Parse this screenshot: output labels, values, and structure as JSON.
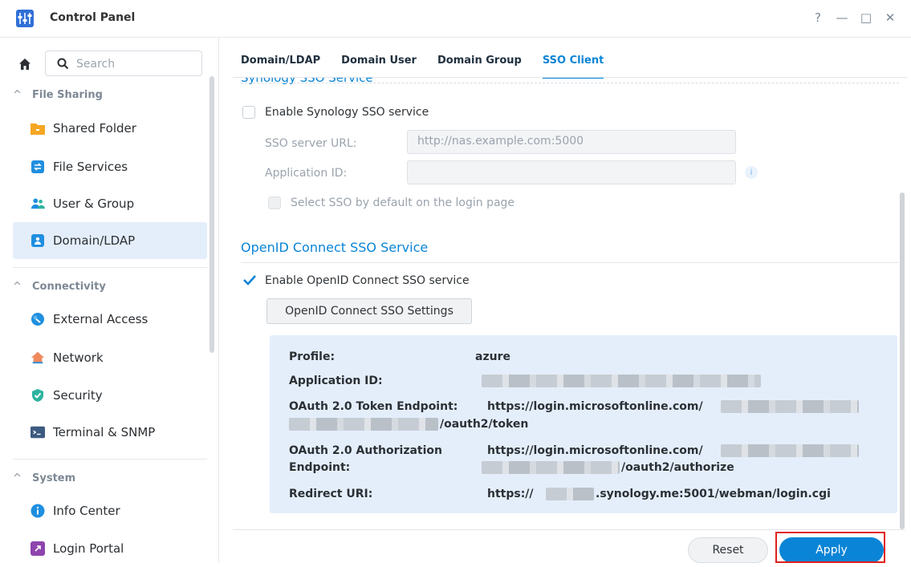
{
  "window": {
    "title": "Control Panel",
    "controls": {
      "help": "?",
      "minimize": "—",
      "maximize": "□",
      "close": "✕"
    }
  },
  "sidebar": {
    "search_placeholder": "Search",
    "sections": {
      "file_sharing": "File Sharing",
      "connectivity": "Connectivity",
      "system": "System"
    },
    "items": {
      "shared_folder": "Shared Folder",
      "file_services": "File Services",
      "user_group": "User & Group",
      "domain_ldap": "Domain/LDAP",
      "external_access": "External Access",
      "network": "Network",
      "security": "Security",
      "terminal_snmp": "Terminal & SNMP",
      "info_center": "Info Center",
      "login_portal": "Login Portal"
    },
    "active_item": "Domain/LDAP"
  },
  "tabs": {
    "domain_ldap": "Domain/LDAP",
    "domain_user": "Domain User",
    "domain_group": "Domain Group",
    "sso_client": "SSO Client",
    "active": "SSO Client"
  },
  "synology_sso": {
    "heading_partial": "Synology SSO Service",
    "enable_label": "Enable Synology SSO service",
    "enable_checked": false,
    "server_url_label": "SSO server URL:",
    "server_url_placeholder": "http://nas.example.com:5000",
    "app_id_label": "Application ID:",
    "app_id_value": "",
    "default_login_label": "Select SSO by default on the login page"
  },
  "openid": {
    "heading": "OpenID Connect SSO Service",
    "enable_label": "Enable OpenID Connect SSO service",
    "enable_checked": true,
    "settings_button": "OpenID Connect SSO Settings",
    "info": {
      "profile_label": "Profile:",
      "profile_value": "azure",
      "app_id_label": "Application ID:",
      "token_label": "OAuth 2.0 Token Endpoint:",
      "token_prefix": "https://login.microsoftonline.com/",
      "token_suffix": "/oauth2/token",
      "auth_label_1": "OAuth 2.0 Authorization",
      "auth_label_2": "Endpoint:",
      "auth_prefix": "https://login.microsoftonline.com/",
      "auth_suffix": "/oauth2/authorize",
      "redirect_label": "Redirect URI:",
      "redirect_prefix": "https://",
      "redirect_suffix": ".synology.me:5001/webman/login.cgi"
    }
  },
  "footer": {
    "reset": "Reset",
    "apply": "Apply"
  },
  "colors": {
    "accent": "#0a84d6",
    "highlight": "#e0201a",
    "panel": "#e4eefb"
  }
}
